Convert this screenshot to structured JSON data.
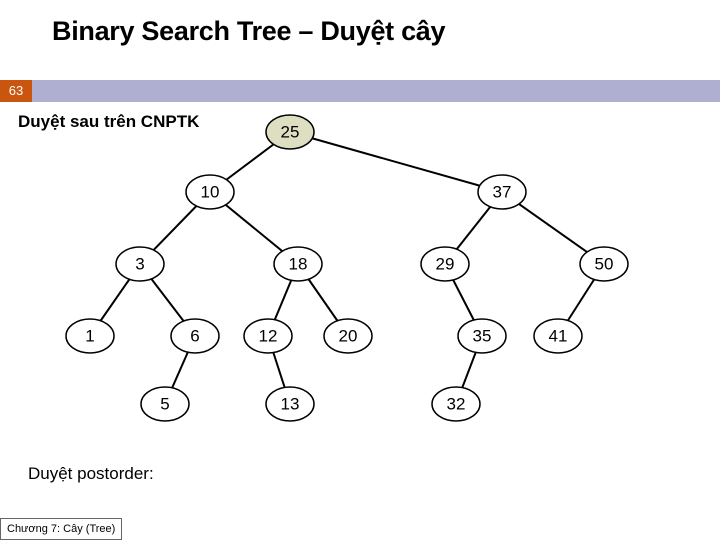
{
  "title": "Binary Search Tree – Duyệt cây",
  "page_number": "63",
  "subtitle": "Duyệt sau trên CNPTK",
  "postorder_label": "Duyệt postorder:",
  "footer": "Chương 7: Cây (Tree)",
  "chart_data": {
    "type": "tree",
    "annotation": "Binary search tree with root 25 highlighted",
    "root": 25,
    "edges": [
      [
        25,
        10
      ],
      [
        25,
        37
      ],
      [
        10,
        3
      ],
      [
        10,
        18
      ],
      [
        37,
        29
      ],
      [
        37,
        50
      ],
      [
        3,
        1
      ],
      [
        3,
        6
      ],
      [
        18,
        12
      ],
      [
        18,
        20
      ],
      [
        29,
        35
      ],
      [
        50,
        41
      ],
      [
        6,
        5
      ],
      [
        12,
        13
      ],
      [
        35,
        32
      ]
    ],
    "nodes": {
      "n25": 25,
      "n10": 10,
      "n37": 37,
      "n3": 3,
      "n18": 18,
      "n29": 29,
      "n50": 50,
      "n1": 1,
      "n6": 6,
      "n12": 12,
      "n20": 20,
      "n35": 35,
      "n41": 41,
      "n5": 5,
      "n13": 13,
      "n32": 32
    },
    "traversal": "postorder"
  }
}
